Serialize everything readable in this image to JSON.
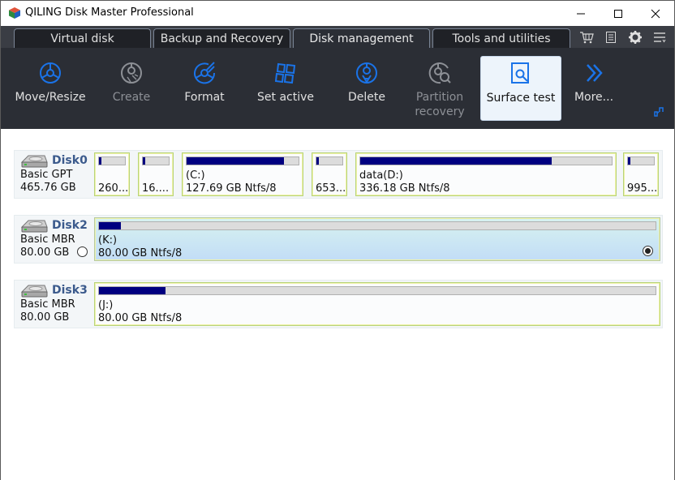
{
  "window": {
    "title": "QILING Disk Master Professional",
    "controls": {
      "minimize": "—",
      "maximize": "☐",
      "close": "✕"
    }
  },
  "tabs": [
    {
      "label": "Virtual disk",
      "active": false
    },
    {
      "label": "Backup and Recovery",
      "active": false
    },
    {
      "label": "Disk management",
      "active": true
    },
    {
      "label": "Tools and utilities",
      "active": false
    }
  ],
  "tab_tools": [
    {
      "icon": "cart-icon"
    },
    {
      "icon": "log-icon"
    },
    {
      "icon": "gear-icon"
    },
    {
      "icon": "menu-icon"
    }
  ],
  "ribbon": {
    "accent": "#1a73e8",
    "buttons": [
      {
        "label": "Move/Resize",
        "icon": "move-resize-icon",
        "enabled": true
      },
      {
        "label": "Create",
        "icon": "create-partition-icon",
        "enabled": false
      },
      {
        "label": "Format",
        "icon": "format-icon",
        "enabled": true
      },
      {
        "label": "Set active",
        "icon": "set-active-icon",
        "enabled": true
      },
      {
        "label": "Delete",
        "icon": "delete-partition-icon",
        "enabled": true
      },
      {
        "label": "Partition recovery",
        "icon": "partition-recovery-icon",
        "enabled": false
      },
      {
        "label": "Surface test",
        "icon": "surface-test-icon",
        "enabled": true,
        "selected": true
      },
      {
        "label": "More...",
        "icon": "more-chevrons-icon",
        "enabled": true
      }
    ]
  },
  "disks": [
    {
      "name": "Disk0",
      "type": "Basic GPT",
      "size": "465.76 GB",
      "radio": false,
      "partitions": [
        {
          "label": "",
          "info": "260...",
          "used_pct": 8
        },
        {
          "label": "",
          "info": "16....",
          "used_pct": 8
        },
        {
          "label": "(C:)",
          "info": "127.69 GB Ntfs/8",
          "used_pct": 87
        },
        {
          "label": "",
          "info": "653...",
          "used_pct": 10
        },
        {
          "label": "data(D:)",
          "info": "336.18 GB Ntfs/8",
          "used_pct": 76
        },
        {
          "label": "",
          "info": "995...",
          "used_pct": 10
        }
      ]
    },
    {
      "name": "Disk2",
      "type": "Basic MBR",
      "size": "80.00 GB",
      "radio": true,
      "partitions": [
        {
          "label": "(K:)",
          "info": "80.00 GB Ntfs/8",
          "used_pct": 1,
          "selected": true
        }
      ]
    },
    {
      "name": "Disk3",
      "type": "Basic MBR",
      "size": "80.00 GB",
      "radio": false,
      "partitions": [
        {
          "label": "(J:)",
          "info": "80.00 GB Ntfs/8",
          "used_pct": 12
        }
      ]
    }
  ]
}
